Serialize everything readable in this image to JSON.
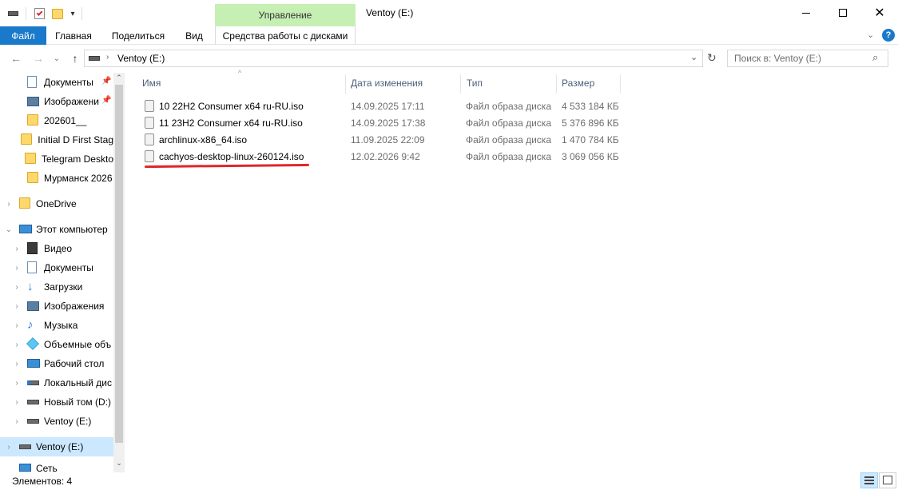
{
  "window": {
    "title": "Ventoy (E:)",
    "context_tab_group": "Управление",
    "minimize_icon": "minimize-icon",
    "maximize_icon": "maximize-icon",
    "close_icon": "close-icon"
  },
  "ribbon": {
    "tabs": [
      "Файл",
      "Главная",
      "Поделиться",
      "Вид",
      "Средства работы с дисками"
    ],
    "accent": "#1979ca"
  },
  "address": {
    "path": "Ventoy (E:)",
    "search_placeholder": "Поиск в: Ventoy (E:)"
  },
  "sidebar": {
    "quick_access": [
      {
        "label": "Документы",
        "icon": "document-icon",
        "pinned": true
      },
      {
        "label": "Изображени",
        "icon": "pictures-icon",
        "pinned": true
      },
      {
        "label": "202601__",
        "icon": "folder-icon",
        "pinned": false
      },
      {
        "label": "Initial D First Stag",
        "icon": "folder-icon",
        "pinned": false
      },
      {
        "label": "Telegram Deskto",
        "icon": "folder-icon",
        "pinned": false
      },
      {
        "label": "Мурманск 2026",
        "icon": "folder-icon",
        "pinned": false
      }
    ],
    "onedrive": "OneDrive",
    "this_pc": "Этот компьютер",
    "pc_items": [
      {
        "label": "Видео",
        "icon": "video-icon"
      },
      {
        "label": "Документы",
        "icon": "document-icon"
      },
      {
        "label": "Загрузки",
        "icon": "download-icon"
      },
      {
        "label": "Изображения",
        "icon": "pictures-icon"
      },
      {
        "label": "Музыка",
        "icon": "music-icon"
      },
      {
        "label": "Объемные объ",
        "icon": "3d-objects-icon"
      },
      {
        "label": "Рабочий стол",
        "icon": "desktop-icon"
      },
      {
        "label": "Локальный дис",
        "icon": "drive-icon"
      },
      {
        "label": "Новый том (D:)",
        "icon": "drive-icon"
      },
      {
        "label": "Ventoy (E:)",
        "icon": "drive-icon"
      }
    ],
    "selected": "Ventoy (E:)",
    "network_partial": "Сеть"
  },
  "columns": {
    "name": "Имя",
    "date": "Дата изменения",
    "type": "Тип",
    "size": "Размер"
  },
  "files": [
    {
      "name": "10 22H2 Consumer x64 ru-RU.iso",
      "date": "14.09.2025 17:11",
      "type": "Файл образа диска",
      "size": "4 533 184 КБ"
    },
    {
      "name": "11 23H2 Consumer x64 ru-RU.iso",
      "date": "14.09.2025 17:38",
      "type": "Файл образа диска",
      "size": "5 376 896 КБ"
    },
    {
      "name": "archlinux-x86_64.iso",
      "date": "11.09.2025 22:09",
      "type": "Файл образа диска",
      "size": "1 470 784 КБ"
    },
    {
      "name": "cachyos-desktop-linux-260124.iso",
      "date": "12.02.2026 9:42",
      "type": "Файл образа диска",
      "size": "3 069 056 КБ",
      "highlighted": true
    }
  ],
  "highlight_color": "#e0262b",
  "status": {
    "items_count": "Элементов: 4"
  }
}
